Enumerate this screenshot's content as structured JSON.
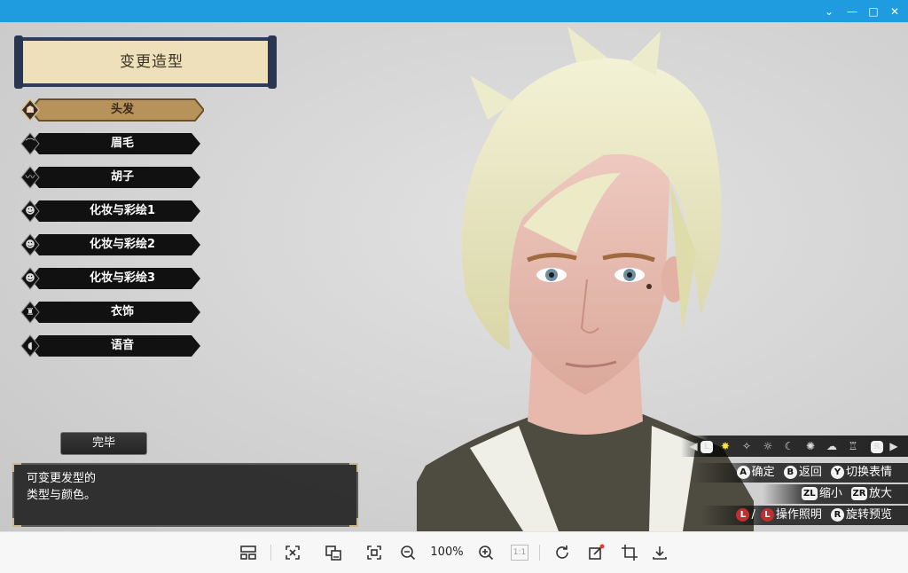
{
  "window": {
    "controls": [
      "chevron-down",
      "minimize",
      "maximize",
      "close"
    ]
  },
  "panel": {
    "title": "变更造型",
    "items": [
      {
        "label": "头发",
        "icon": "hair-icon",
        "active": true
      },
      {
        "label": "眉毛",
        "icon": "eyebrow-icon",
        "active": false
      },
      {
        "label": "胡子",
        "icon": "mustache-icon",
        "active": false
      },
      {
        "label": "化妆与彩绘1",
        "icon": "face-paint-icon",
        "active": false
      },
      {
        "label": "化妆与彩绘2",
        "icon": "face-paint-icon",
        "active": false
      },
      {
        "label": "化妆与彩绘3",
        "icon": "face-paint-icon",
        "active": false
      },
      {
        "label": "衣饰",
        "icon": "outfit-icon",
        "active": false
      },
      {
        "label": "语音",
        "icon": "voice-icon",
        "active": false
      }
    ],
    "done_label": "完毕",
    "description": "可变更发型的\n类型与颜色。"
  },
  "lighting": {
    "left_key": "L",
    "right_key": "R"
  },
  "help": {
    "row1": [
      {
        "key": "A",
        "label": "确定"
      },
      {
        "key": "B",
        "label": "返回"
      },
      {
        "key": "Y",
        "label": "切换表情"
      }
    ],
    "row2": [
      {
        "key": "ZL",
        "label": "缩小"
      },
      {
        "key": "ZR",
        "label": "放大"
      }
    ],
    "row3_sep": "/",
    "row3": [
      {
        "key": "L",
        "label": "操作照明"
      },
      {
        "key": "R",
        "label": "旋转预览"
      }
    ]
  },
  "toolbar": {
    "zoom": "100%",
    "actual_size": "1:1"
  },
  "colors": {
    "titlebar": "#1f9be0",
    "menu_active": "#b7925a",
    "menu_bg": "#111111",
    "hair": "#e9e8c2"
  }
}
